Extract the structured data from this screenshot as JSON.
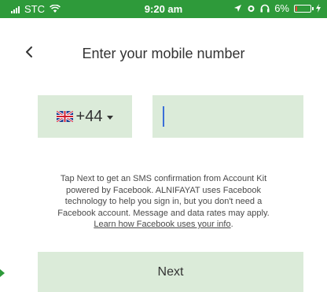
{
  "status_bar": {
    "carrier": "STC",
    "time": "9:20 am",
    "battery": "6%",
    "background_color": "#2e9a3a"
  },
  "header": {
    "back_icon": "chevron-left-icon",
    "title": "Enter your mobile number"
  },
  "country_picker": {
    "flag_icon": "uk-flag-icon",
    "code": "+44",
    "chevron_icon": "chevron-down-icon"
  },
  "phone_input": {
    "value": "",
    "placeholder": ""
  },
  "disclaimer": {
    "line1": "Tap Next to get an SMS confirmation from Account Kit",
    "line2": "powered by Facebook. ALNIFAYAT uses Facebook",
    "line3": "technology to help you sign in, but you don't need a",
    "line4": "Facebook account. Message and data rates may apply.",
    "link_text": "Learn how Facebook uses your info",
    "link_suffix": "."
  },
  "next_button": {
    "label": "Next"
  },
  "colors": {
    "accent_green": "#2e9a3a",
    "field_background": "#dbebd9",
    "cursor_blue": "#3b6fd8"
  }
}
